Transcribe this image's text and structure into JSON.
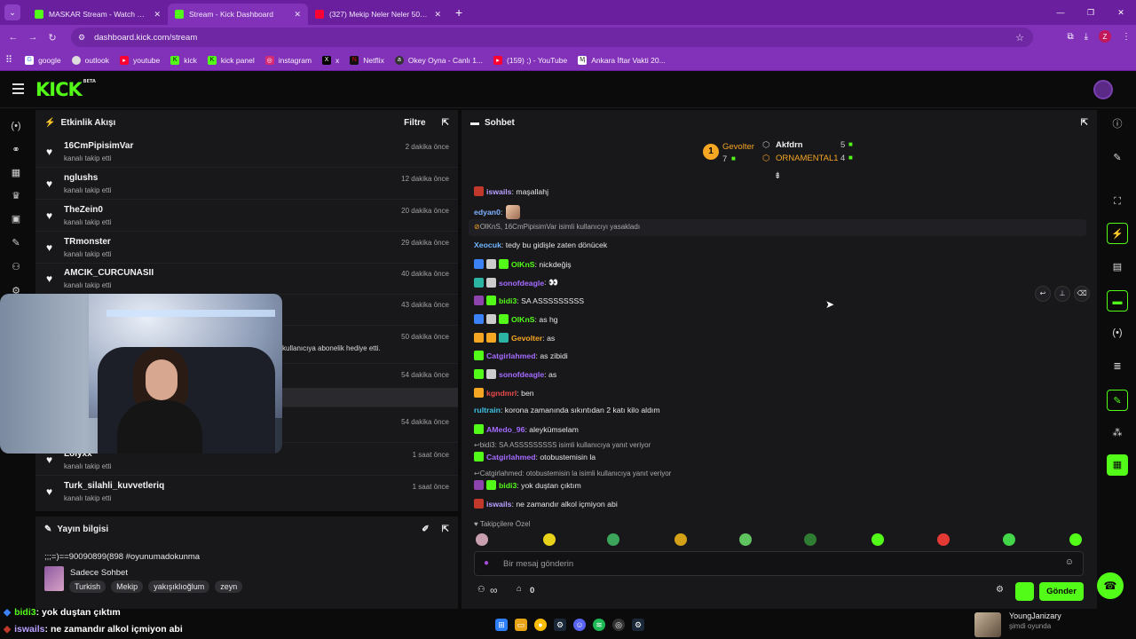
{
  "browser": {
    "tabs": [
      {
        "title": "MASKAR Stream - Watch Live o",
        "favicon_color": "#53fc18"
      },
      {
        "title": "Stream - Kick Dashboard",
        "favicon_color": "#53fc18"
      },
      {
        "title": "(327) Mekip Neler Neler 50.Bölü",
        "favicon_color": "#ff0033"
      }
    ],
    "url": "dashboard.kick.com/stream",
    "profile_initial": "Z",
    "bookmarks": [
      {
        "label": "google",
        "icon": "google-icon",
        "color": "#4285f4"
      },
      {
        "label": "outlook",
        "icon": "globe-icon",
        "color": "#5a5a5a"
      },
      {
        "label": "youtube",
        "icon": "youtube-icon",
        "color": "#ff0033"
      },
      {
        "label": "kick",
        "icon": "kick-icon",
        "color": "#53fc18"
      },
      {
        "label": "kick panel",
        "icon": "kick-icon",
        "color": "#53fc18"
      },
      {
        "label": "instagram",
        "icon": "instagram-icon",
        "color": "#d62976"
      },
      {
        "label": "x",
        "icon": "x-icon",
        "color": "#000000"
      },
      {
        "label": "Netflix",
        "icon": "netflix-icon",
        "color": "#e50914"
      },
      {
        "label": "Okey Oyna - Canlı 1...",
        "icon": "okey-icon",
        "color": "#2a2a2a"
      },
      {
        "label": "(159) ;) - YouTube",
        "icon": "youtube-icon",
        "color": "#ff0033"
      },
      {
        "label": "Ankara İftar Vakti 20...",
        "icon": "iftar-icon",
        "color": "#3a2a1a"
      }
    ]
  },
  "app": {
    "logo": "KICK",
    "logo_badge": "BETA",
    "accent": "#53fc18",
    "panel_bg": "#18181b"
  },
  "activity": {
    "title": "Etkinlik Akışı",
    "filter_label": "Filtre",
    "items": [
      {
        "name": "16CmPipisimVar",
        "action": "kanalı takip etti",
        "time": "2 dakika önce"
      },
      {
        "name": "nglushs",
        "action": "kanalı takip etti",
        "time": "12 dakika önce"
      },
      {
        "name": "TheZein0",
        "action": "kanalı takip etti",
        "time": "20 dakika önce"
      },
      {
        "name": "TRmonster",
        "action": "kanalı takip etti",
        "time": "29 dakika önce"
      },
      {
        "name": "AMCIK_CURCUNASII",
        "action": "kanalı takip etti",
        "time": "40 dakika önce"
      },
      {
        "name": "",
        "action": "",
        "time": "43 dakika önce"
      },
      {
        "name": "",
        "action": "kullanıcıya abonelik hediye etti.",
        "time": "50 dakika önce"
      },
      {
        "name": "",
        "action": "",
        "time": "54 dakika önce"
      },
      {
        "name": "",
        "action": "",
        "time": "54 dakika önce"
      },
      {
        "name": "Loiyxx",
        "action": "kanalı takip etti",
        "time": "1 saat önce"
      },
      {
        "name": "Turk_silahli_kuvvetleriq",
        "action": "kanalı takip etti",
        "time": "1 saat önce"
      }
    ]
  },
  "stream_info": {
    "title": "Yayın bilgisi",
    "stream_title": ";;;=)==90090899(898 #oyunumadokunma",
    "category": "Sadece Sohbet",
    "tags": [
      "Turkish",
      "Mekip",
      "yakışıklıoğlum",
      "zeyn"
    ]
  },
  "chat": {
    "title": "Sohbet",
    "leaderboard": {
      "first": {
        "rank": "1",
        "name": "Gevolter",
        "count": "7"
      },
      "second": {
        "name": "Akfdrn",
        "count": "5"
      },
      "third": {
        "name": "ORNAMENTAL1",
        "count": "4"
      }
    },
    "messages": [
      {
        "user": "iswails",
        "color": "#b9a0ff",
        "text": ": maşallahj",
        "badges": [
          "#c0392b"
        ]
      },
      {
        "user": "edyan0",
        "color": "#7fb2ff",
        "text": ":",
        "badges": [],
        "emote": true
      },
      {
        "system": true,
        "text": "OlKnS, 16CmPipisimVar isimli kullanıcıyı yasakladı"
      },
      {
        "user": "Xeocuk",
        "color": "#6fb6ff",
        "text": ": tedy bu gidişle zaten dönücek",
        "badges": []
      },
      {
        "user": "OlKnS",
        "color": "#53fc18",
        "text": ": nickdeğiş",
        "badges": [
          "#3b82f6",
          "#cccccc",
          "#53fc18"
        ]
      },
      {
        "user": "sonofdeagle",
        "color": "#a46bff",
        "text": ": 👀",
        "badges": [
          "#2bb3a3",
          "#cccccc"
        ]
      },
      {
        "user": "bidi3",
        "color": "#53fc18",
        "text": ": SA ASSSSSSSSS",
        "badges": [
          "#8e44ad",
          "#53fc18"
        ]
      },
      {
        "user": "OlKnS",
        "color": "#53fc18",
        "text": ": as hg",
        "badges": [
          "#3b82f6",
          "#cccccc",
          "#53fc18"
        ]
      },
      {
        "user": "Gevolter",
        "color": "#f5a623",
        "text": ": as",
        "badges": [
          "#f5a623",
          "#f5a623",
          "#2bb3a3"
        ]
      },
      {
        "user": "Catgirlahmed",
        "color": "#a46bff",
        "text": ": as zibidi",
        "badges": [
          "#53fc18"
        ]
      },
      {
        "user": "sonofdeagle",
        "color": "#a46bff",
        "text": ": as",
        "badges": [
          "#53fc18",
          "#cccccc"
        ]
      },
      {
        "user": "kgndmrl",
        "color": "#e84a4a",
        "text": ": ben",
        "badges": [
          "#f5a623"
        ]
      },
      {
        "user": "rultrain",
        "color": "#3fc1e0",
        "text": ": korona zamanında sıkıntıdan 2 katı kilo aldım",
        "badges": []
      },
      {
        "user": "AMedo_96",
        "color": "#a46bff",
        "text": ": aleykümselam",
        "badges": [
          "#53fc18"
        ]
      },
      {
        "system": true,
        "reply": true,
        "text": "bidi3: SA ASSSSSSSSS isimli kullanıcıya yanıt veriyor"
      },
      {
        "user": "Catgirlahmed",
        "color": "#a46bff",
        "text": ": otobustemisin la",
        "badges": [
          "#53fc18"
        ]
      },
      {
        "system": true,
        "reply": true,
        "text": "Catgirlahmed: otobustemisin la isimli kullanıcıya yanıt veriyor"
      },
      {
        "user": "bidi3",
        "color": "#53fc18",
        "text": ": yok duştan çıktım",
        "badges": [
          "#8e44ad",
          "#53fc18"
        ]
      },
      {
        "user": "iswails",
        "color": "#b9a0ff",
        "text": ": ne zamandır alkol içmiyon abi",
        "badges": [
          "#c0392b"
        ]
      }
    ],
    "emote_label": "Takipçilere Özel",
    "input_placeholder": "Bir mesaj gönderin",
    "bottom_infinity": "∞",
    "bottom_count": "0",
    "send_label": "Gönder"
  },
  "overlay": {
    "line1_user": "bidi3",
    "line1_text": ": yok duştan çıktım",
    "line2_user": "iswails",
    "line2_text": ": ne zamandır alkol içmiyon abi"
  },
  "now_playing": {
    "title": "YoungJanizary",
    "subtitle": "şimdi oyunda"
  }
}
